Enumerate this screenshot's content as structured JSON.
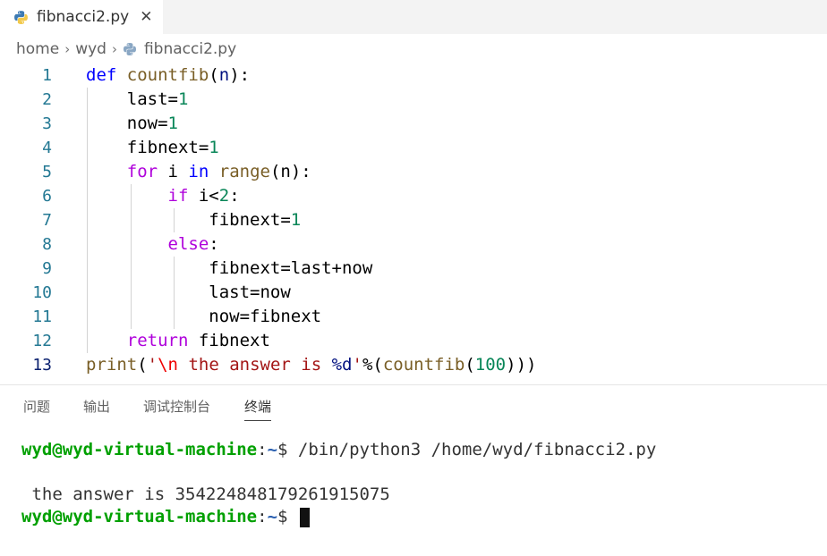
{
  "tab": {
    "title": "fibnacci2.py",
    "close_glyph": "✕",
    "icon": "python-icon"
  },
  "breadcrumb": {
    "items": [
      "home",
      "wyd"
    ],
    "file": "fibnacci2.py",
    "separator": "›"
  },
  "editor": {
    "active_line": 13,
    "lines": [
      {
        "n": "1"
      },
      {
        "n": "2"
      },
      {
        "n": "3"
      },
      {
        "n": "4"
      },
      {
        "n": "5"
      },
      {
        "n": "6"
      },
      {
        "n": "7"
      },
      {
        "n": "8"
      },
      {
        "n": "9"
      },
      {
        "n": "10"
      },
      {
        "n": "11"
      },
      {
        "n": "12"
      },
      {
        "n": "13"
      }
    ],
    "tokens": {
      "def": "def",
      "countfib": "countfib",
      "n": "n",
      "open_paren": "(",
      "close_colon": "):",
      "last_eq": "last=",
      "one": "1",
      "now_eq": "now=",
      "fibnext_eq": "fibnext=",
      "for": "for",
      "i": " i ",
      "in": "in",
      "range": "range",
      "range_args": "(n):",
      "if": "if",
      "i_lt": " i<",
      "two": "2",
      "colon": ":",
      "else": "else",
      "fibnext_lastnow": "fibnext=last+now",
      "last_now": "last=now",
      "now_fibnext": "now=fibnext",
      "return": "return",
      "ret_val": " fibnext",
      "print": "print",
      "p_open": "(",
      "str_open": "'",
      "esc_n": "\\n",
      "str_body": " the answer is ",
      "fmt": "%d",
      "str_close": "'",
      "mod": "%(",
      "call": "countfib",
      "call_open": "(",
      "hundred": "100",
      "close_all": ")))"
    }
  },
  "panel": {
    "tabs": [
      "问题",
      "输出",
      "调试控制台",
      "终端"
    ],
    "active_tab": "终端"
  },
  "terminal": {
    "prompt_user": "wyd@wyd-virtual-machine",
    "prompt_sep": ":",
    "prompt_path": "~",
    "prompt_end": "$ ",
    "command": "/bin/python3 /home/wyd/fibnacci2.py",
    "output": " the answer is 354224848179261915075"
  },
  "colors": {
    "keyword": "#0000ff",
    "control": "#af00db",
    "function": "#795e26",
    "number": "#098658",
    "string": "#a31515",
    "prompt_user": "#00a000"
  }
}
